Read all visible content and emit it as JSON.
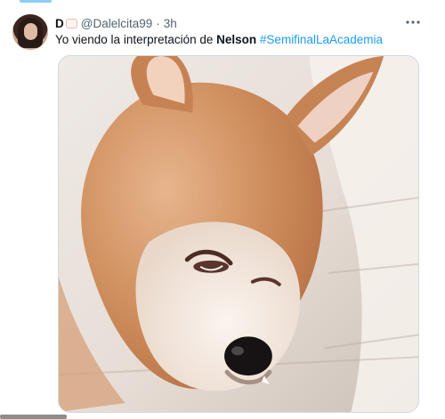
{
  "tweet": {
    "display_name": "D",
    "handle": "@Dalelcita99",
    "separator": "·",
    "time": "3h",
    "text_prefix": "Yo viendo la interpretación de ",
    "text_bold": "Nelson",
    "hashtag": "#SemifinalLaAcademia",
    "more_icon": "more-horizontal-icon",
    "avatar_icon": "user-avatar",
    "media_description_icon": "dog-meme-image"
  },
  "colors": {
    "text": "#0f1419",
    "secondary": "#536471",
    "hashtag": "#1d9bf0",
    "border": "#cfd9de",
    "top_accent": "#8ecdf8"
  }
}
